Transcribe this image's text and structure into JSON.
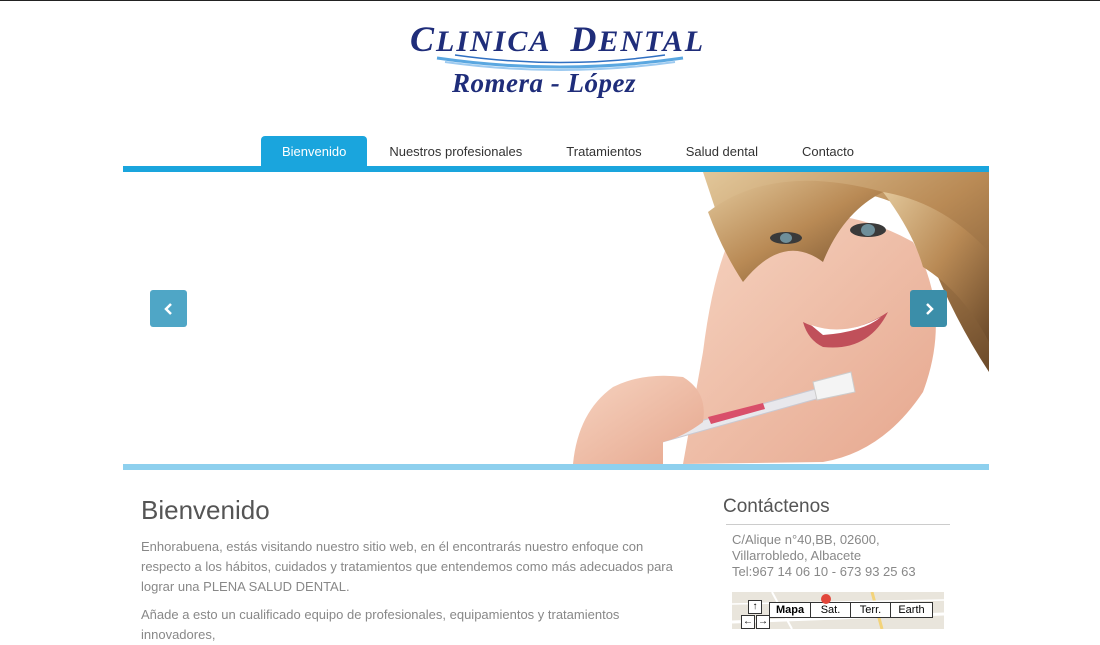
{
  "logo": {
    "line1_first_initial": "C",
    "line1_first_rest": "LINICA",
    "line1_second_initial": "D",
    "line1_second_rest": "ENTAL",
    "line2": "Romera - López"
  },
  "nav": {
    "items": [
      {
        "label": "Bienvenido",
        "active": true
      },
      {
        "label": "Nuestros profesionales",
        "active": false
      },
      {
        "label": "Tratamientos",
        "active": false
      },
      {
        "label": "Salud dental",
        "active": false
      },
      {
        "label": "Contacto",
        "active": false
      }
    ]
  },
  "slider": {
    "prev_icon": "chevron-left-icon",
    "next_icon": "chevron-right-icon"
  },
  "main": {
    "heading": "Bienvenido",
    "paragraphs": [
      "Enhorabuena, estás visitando nuestro sitio web, en él encontrarás nuestro enfoque con respecto a los hábitos, cuidados y tratamientos que entendemos como más adecuados para lograr una PLENA SALUD DENTAL.",
      "Añade a esto un cualificado equipo de profesionales, equipamientos y tratamientos innovadores,"
    ]
  },
  "sidebar": {
    "heading": "Contáctenos",
    "address_line1": "C/Alique n°40,BB, 02600,",
    "address_line2": "Villarrobledo, Albacete",
    "phone": "Tel:967 14 06 10 - 673 93 25 63"
  },
  "map": {
    "buttons": [
      "Mapa",
      "Sat.",
      "Terr.",
      "Earth"
    ]
  },
  "colors": {
    "accent": "#1aa5dd",
    "accent_light": "#8ed0ee",
    "logo_blue": "#1f2d7a"
  }
}
